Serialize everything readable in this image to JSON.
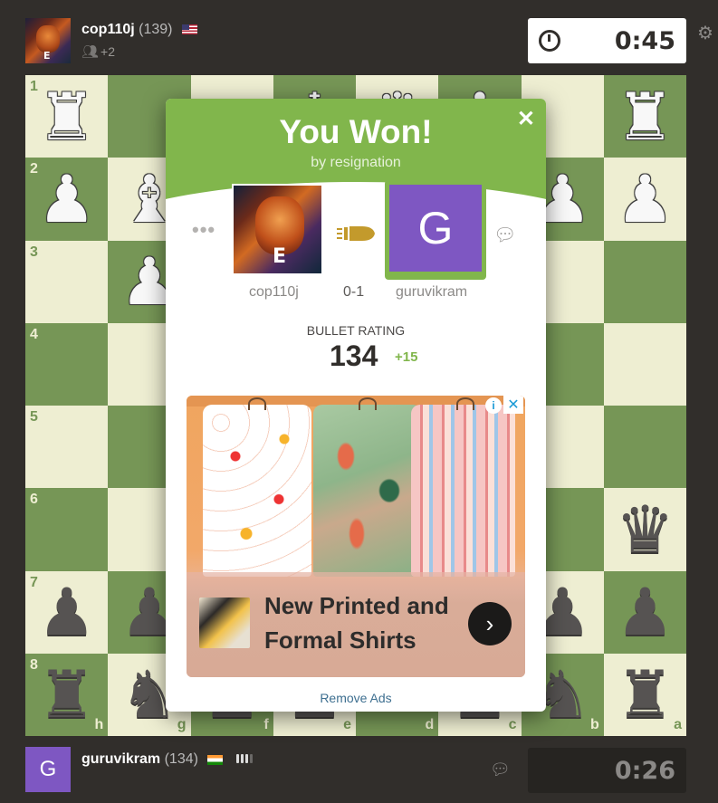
{
  "top_player": {
    "name": "cop110j",
    "rating": "(139)",
    "flag": "US",
    "watchers": "+2",
    "avatar_badge": "E",
    "clock": "0:45"
  },
  "bottom_player": {
    "name": "guruvikram",
    "rating": "(134)",
    "flag": "IN",
    "avatar_letter": "G",
    "clock": "0:26"
  },
  "board": {
    "colors": {
      "light": "#eeeed2",
      "dark": "#769656"
    },
    "ranks": [
      "1",
      "2",
      "3",
      "4",
      "5",
      "6",
      "7",
      "8"
    ],
    "files": [
      "h",
      "g",
      "f",
      "e",
      "d",
      "c",
      "b",
      "a"
    ],
    "rows": [
      [
        "wR",
        "",
        "",
        "wK",
        "wQ",
        "wB",
        "",
        "wR"
      ],
      [
        "wP",
        "wB",
        "",
        "",
        "",
        "",
        "wP",
        "wP"
      ],
      [
        "",
        "wP",
        "",
        "",
        "",
        "",
        "",
        ""
      ],
      [
        "",
        "",
        "",
        "",
        "",
        "",
        "",
        ""
      ],
      [
        "",
        "",
        "",
        "",
        "",
        "",
        "",
        ""
      ],
      [
        "",
        "",
        "",
        "",
        "",
        "",
        "",
        "bQ"
      ],
      [
        "bP",
        "bP",
        "",
        "",
        "",
        "",
        "bP",
        "bP"
      ],
      [
        "bR",
        "bN",
        "bP",
        "bP",
        "",
        "bP",
        "bN",
        "bR"
      ]
    ]
  },
  "modal": {
    "title": "You Won!",
    "subtitle": "by resignation",
    "close_icon": "close-icon",
    "winner_name": "cop110j",
    "winner_badge": "E",
    "loser_name": "guruvikram",
    "loser_letter": "G",
    "score": "0-1",
    "rating_label": "BULLET RATING",
    "rating_value": "134",
    "rating_delta": "+15",
    "remove_ads": "Remove Ads",
    "accent": "#81b64c"
  },
  "ad": {
    "headline": "New Printed and Formal Shirts",
    "info_icon": "info-icon",
    "close_icon": "ad-close-icon",
    "go_icon": "chevron-right-icon"
  },
  "icons": {
    "gear": "gear-icon",
    "chat": "chat-icon",
    "clock": "clock-icon",
    "bullet": "bullet-icon",
    "more": "more-icon"
  }
}
